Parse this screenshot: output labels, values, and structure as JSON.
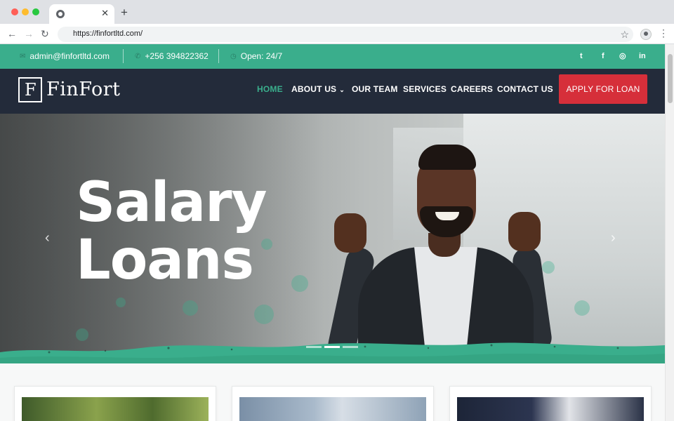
{
  "browser": {
    "url": "https://finfortltd.com/",
    "close_glyph": "✕",
    "new_tab_glyph": "+",
    "back_glyph": "←",
    "forward_glyph": "→",
    "reload_glyph": "↻",
    "star_glyph": "☆",
    "menu_glyph": "⋮"
  },
  "topbar": {
    "email": "admin@finfortltd.com",
    "phone": "+256 394822362",
    "hours": "Open: 24/7",
    "email_icon": "envelope-icon",
    "phone_icon": "phone-icon",
    "hours_icon": "clock-icon",
    "social": [
      {
        "name": "twitter-icon",
        "glyph": "t"
      },
      {
        "name": "facebook-icon",
        "glyph": "f"
      },
      {
        "name": "instagram-icon",
        "glyph": "◎"
      },
      {
        "name": "linkedin-icon",
        "glyph": "in"
      }
    ]
  },
  "nav": {
    "logo_letter": "F",
    "logo_text": "FinFort",
    "items": [
      {
        "label": "HOME",
        "active": true
      },
      {
        "label": "ABOUT US",
        "dropdown": true
      },
      {
        "label": "OUR TEAM"
      },
      {
        "label": "SERVICES"
      },
      {
        "label": "CAREERS"
      },
      {
        "label": "CONTACT US"
      }
    ],
    "chevron": "⌄",
    "cta": "APPLY FOR LOAN"
  },
  "hero": {
    "title_line1": "Salary",
    "title_line2": "Loans",
    "prev_glyph": "‹",
    "next_glyph": "›",
    "slide_count": 3,
    "active_slide": 2
  },
  "colors": {
    "brand_green": "#3aae8c",
    "nav_dark": "#232b3a",
    "cta_red": "#d62f3a"
  }
}
